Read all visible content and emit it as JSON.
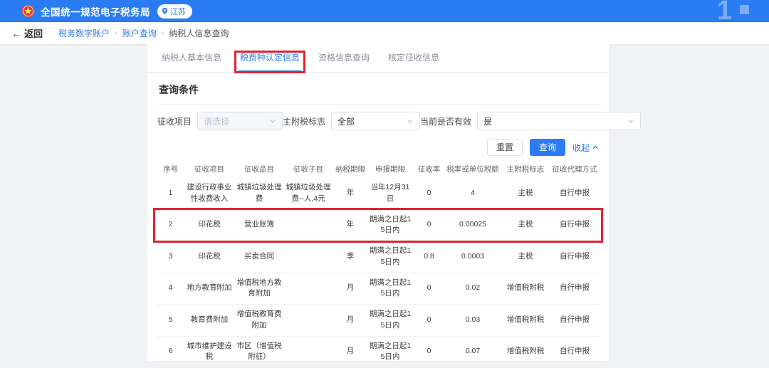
{
  "header": {
    "title": "全国统一规范电子税务局",
    "region_badge": "江苏",
    "watermark": "1"
  },
  "breadcrumb": {
    "back_label": "返回",
    "items": [
      {
        "label": "税务数字账户"
      },
      {
        "label": "账户查询"
      },
      {
        "label": "纳税人信息查询"
      }
    ]
  },
  "tabs": [
    {
      "label": "纳税人基本信息",
      "active": false
    },
    {
      "label": "税费种认定信息",
      "active": true
    },
    {
      "label": "资格信息查询",
      "active": false
    },
    {
      "label": "核定征收信息",
      "active": false
    }
  ],
  "query_section": {
    "title": "查询条件",
    "fields": [
      {
        "label": "征收项目",
        "value": "",
        "placeholder": "请选择"
      },
      {
        "label": "主附税标志",
        "value": "全部"
      },
      {
        "label": "当前是否有效",
        "value": "是"
      }
    ],
    "reset_label": "重置",
    "search_label": "查询",
    "collapse_label": "收起"
  },
  "table": {
    "headers": [
      "序号",
      "征收项目",
      "征收品目",
      "征收子目",
      "纳税期限",
      "申报期限",
      "征收率",
      "税率或单位税额",
      "主附税标志",
      "征收代理方式"
    ],
    "rows": [
      [
        "1",
        "建设行政事业性收费收入",
        "城镇垃圾处理费",
        "城镇垃圾处理费--人,4元",
        "年",
        "当年12月31日",
        "0",
        "4",
        "主税",
        "自行申报"
      ],
      [
        "2",
        "印花税",
        "营业账簿",
        "",
        "年",
        "期满之日起15日内",
        "0",
        "0.00025",
        "主税",
        "自行申报"
      ],
      [
        "3",
        "印花税",
        "买卖合同",
        "",
        "季",
        "期满之日起15日内",
        "0.8",
        "0.0003",
        "主税",
        "自行申报"
      ],
      [
        "4",
        "地方教育附加",
        "增值税地方教育附加",
        "",
        "月",
        "期满之日起15日内",
        "0",
        "0.02",
        "增值税附税",
        "自行申报"
      ],
      [
        "5",
        "教育费附加",
        "增值税教育费附加",
        "",
        "月",
        "期满之日起15日内",
        "0",
        "0.03",
        "增值税附税",
        "自行申报"
      ],
      [
        "6",
        "城市维护建设税",
        "市区（增值税附征）",
        "",
        "月",
        "期满之日起15日内",
        "0",
        "0.07",
        "增值税附税",
        "自行申报"
      ]
    ],
    "highlighted_row": 2
  },
  "annotations": {
    "color": "#e02233",
    "boxes": [
      {
        "target": "active-tab"
      },
      {
        "target": "highlighted-row"
      }
    ]
  },
  "colors": {
    "primary_blue": "#2b7cf2",
    "annotation_red": "#e02233",
    "page_background": "#f0f2f5"
  }
}
